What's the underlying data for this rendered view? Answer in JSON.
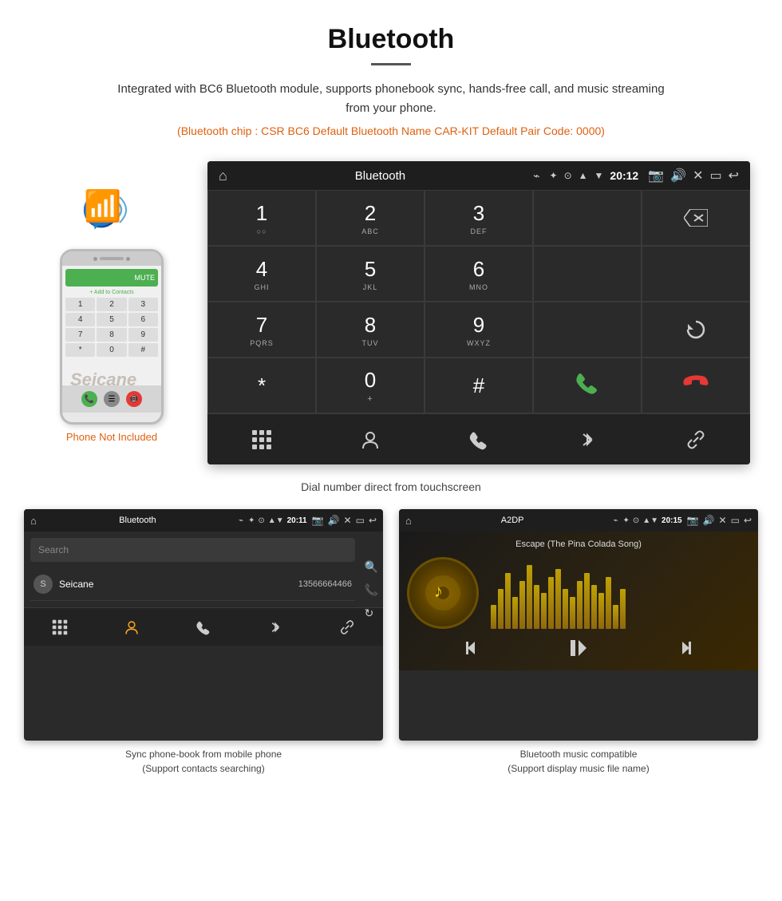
{
  "page": {
    "title": "Bluetooth",
    "description": "Integrated with BC6 Bluetooth module, supports phonebook sync, hands-free call, and music streaming from your phone.",
    "specs": "(Bluetooth chip : CSR BC6    Default Bluetooth Name CAR-KIT    Default Pair Code: 0000)",
    "dial_caption": "Dial number direct from touchscreen",
    "phonebook_caption_line1": "Sync phone-book from mobile phone",
    "phonebook_caption_line2": "(Support contacts searching)",
    "music_caption_line1": "Bluetooth music compatible",
    "music_caption_line2": "(Support display music file name)"
  },
  "phone_aside": {
    "not_included": "Phone Not Included",
    "seicane_watermark": "Seicane"
  },
  "dial_screen": {
    "status_bar": {
      "title": "Bluetooth",
      "usb_icon": "⌁",
      "time": "20:12"
    },
    "keys": [
      {
        "main": "1",
        "sub": "○○"
      },
      {
        "main": "2",
        "sub": "ABC"
      },
      {
        "main": "3",
        "sub": "DEF"
      },
      {
        "main": "",
        "sub": ""
      },
      {
        "main": "⌫",
        "sub": ""
      },
      {
        "main": "4",
        "sub": "GHI"
      },
      {
        "main": "5",
        "sub": "JKL"
      },
      {
        "main": "6",
        "sub": "MNO"
      },
      {
        "main": "",
        "sub": ""
      },
      {
        "main": "",
        "sub": ""
      },
      {
        "main": "7",
        "sub": "PQRS"
      },
      {
        "main": "8",
        "sub": "TUV"
      },
      {
        "main": "9",
        "sub": "WXYZ"
      },
      {
        "main": "",
        "sub": ""
      },
      {
        "main": "↻",
        "sub": ""
      },
      {
        "main": "*",
        "sub": ""
      },
      {
        "main": "0",
        "sub": "+"
      },
      {
        "main": "#",
        "sub": ""
      },
      {
        "main": "📞call",
        "sub": ""
      },
      {
        "main": "📞end",
        "sub": ""
      }
    ],
    "nav_icons": [
      "⊞",
      "👤",
      "📞",
      "✦",
      "🔗"
    ]
  },
  "phonebook_screen": {
    "status_bar": {
      "title": "Bluetooth",
      "time": "20:11"
    },
    "search_placeholder": "Search",
    "contacts": [
      {
        "initial": "S",
        "name": "Seicane",
        "number": "13566664466"
      }
    ],
    "side_icons": [
      "🔍",
      "📞",
      "↻"
    ],
    "nav_icons": [
      "⊞",
      "👤",
      "📞",
      "✦",
      "🔗"
    ]
  },
  "music_screen": {
    "status_bar": {
      "title": "A2DP",
      "time": "20:15"
    },
    "song_title": "Escape (The Pina Colada Song)",
    "album_icon": "♪",
    "eq_bars": [
      30,
      50,
      70,
      40,
      60,
      80,
      55,
      45,
      65,
      75,
      50,
      40,
      60,
      70,
      55,
      45,
      65,
      30,
      50
    ],
    "controls": [
      "⏮",
      "⏯",
      "⏭"
    ]
  }
}
